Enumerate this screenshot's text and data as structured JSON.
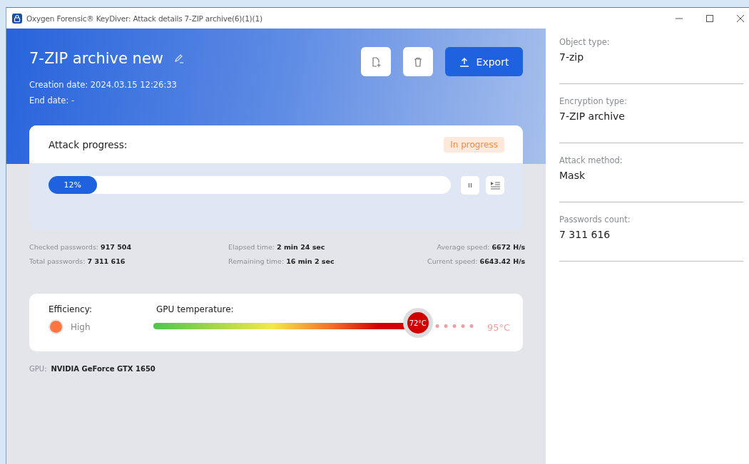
{
  "window": {
    "title": "Oxygen Forensic® KeyDiver: Attack details 7-ZIP archive(6)(1)(1)"
  },
  "header": {
    "title": "7-ZIP archive new",
    "creation_date": "Creation date: 2024.03.15 12:26:33",
    "end_date": "End date: -",
    "export_label": "Export"
  },
  "attack_progress": {
    "title": "Attack progress:",
    "status": "In progress",
    "level": 0.12,
    "reading": "12%"
  },
  "stats": [
    {
      "label": "Checked passwords:",
      "value": "917 504"
    },
    {
      "label": "Elapsed time:",
      "value": "2 min 24 sec"
    },
    {
      "label": "Average speed:",
      "value": "6672 H/s"
    },
    {
      "label": "Total passwords:",
      "value": "7 311 616"
    },
    {
      "label": "Remaining time:",
      "value": "16 min 2 sec"
    },
    {
      "label": "Current speed:",
      "value": "6643.42 H/s"
    }
  ],
  "efficiency": {
    "label": "Efficiency:",
    "value": "High",
    "color": "#ff7540"
  },
  "gpu_temperature": {
    "label": "GPU temperature:",
    "level": 0.82,
    "reading": "72°C",
    "max": "95°C"
  },
  "gpu": {
    "label": "GPU:",
    "value": "NVIDIA GeForce GTX 1650"
  },
  "details": [
    {
      "label": "Object type:",
      "value": "7-zip"
    },
    {
      "label": "Encryption type:",
      "value": "7-ZIP archive"
    },
    {
      "label": "Attack method:",
      "value": "Mask"
    },
    {
      "label": "Passwords count:",
      "value": "7 311 616"
    }
  ]
}
